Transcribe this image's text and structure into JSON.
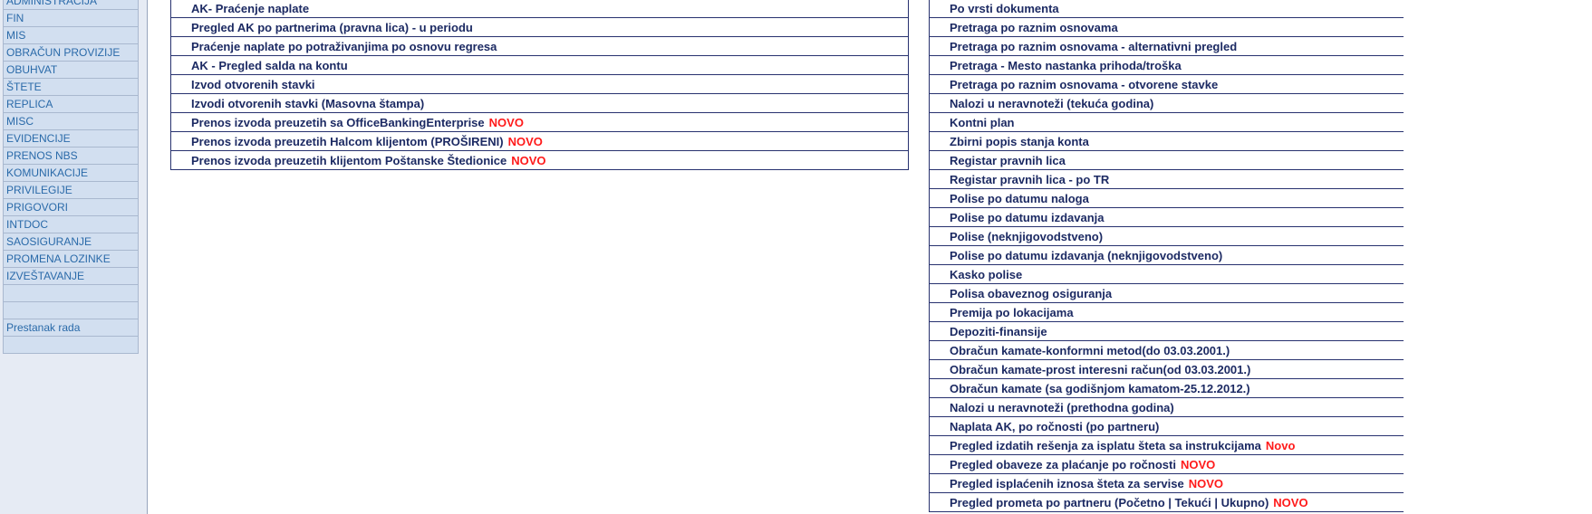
{
  "nav": {
    "items": [
      "ADMINISTRACIJA",
      "FIN",
      "MIS",
      "OBRAČUN PROVIZIJE",
      "OBUHVAT",
      "ŠTETE",
      "REPLICA",
      "MISC",
      "EVIDENCIJE",
      "PRENOS NBS",
      "KOMUNIKACIJE",
      "PRIVILEGIJE",
      "PRIGOVORI",
      "INTDOC",
      "SAOSIGURANJE",
      "PROMENA LOZINKE",
      "IZVEŠTAVANJE",
      "",
      "",
      "Prestanak rada",
      ""
    ]
  },
  "left_reports": [
    {
      "label": "AK- Praćenje naplate",
      "badge": ""
    },
    {
      "label": "Pregled AK po partnerima (pravna lica) - u periodu",
      "badge": ""
    },
    {
      "label": "Praćenje naplate po potraživanjima po osnovu regresa",
      "badge": ""
    },
    {
      "label": "AK - Pregled salda na kontu",
      "badge": ""
    },
    {
      "label": "Izvod otvorenih stavki",
      "badge": ""
    },
    {
      "label": "Izvodi otvorenih stavki (Masovna štampa)",
      "badge": ""
    },
    {
      "label": "Prenos izvoda preuzetih sa OfficeBankingEnterprise",
      "badge": "NOVO"
    },
    {
      "label": "Prenos izvoda preuzetih Halcom klijentom (PROŠIRENI)",
      "badge": "NOVO"
    },
    {
      "label": "Prenos izvoda preuzetih klijentom Poštanske Štedionice",
      "badge": "NOVO"
    }
  ],
  "right_reports": [
    {
      "label": "Po vrsti dokumenta",
      "badge": ""
    },
    {
      "label": "Pretraga po raznim osnovama",
      "badge": ""
    },
    {
      "label": "Pretraga po raznim osnovama - alternativni pregled",
      "badge": ""
    },
    {
      "label": "Pretraga - Mesto nastanka prihoda/troška",
      "badge": ""
    },
    {
      "label": "Pretraga po raznim osnovama - otvorene stavke",
      "badge": ""
    },
    {
      "label": "Nalozi u neravnoteži (tekuća godina)",
      "badge": ""
    },
    {
      "label": "Kontni plan",
      "badge": ""
    },
    {
      "label": "Zbirni popis stanja konta",
      "badge": ""
    },
    {
      "label": "Registar pravnih lica",
      "badge": ""
    },
    {
      "label": "Registar pravnih lica - po TR",
      "badge": ""
    },
    {
      "label": "Polise po datumu naloga",
      "badge": ""
    },
    {
      "label": "Polise po datumu izdavanja",
      "badge": ""
    },
    {
      "label": "Polise (neknjigovodstveno)",
      "badge": ""
    },
    {
      "label": "Polise po datumu izdavanja (neknjigovodstveno)",
      "badge": ""
    },
    {
      "label": "Kasko polise",
      "badge": ""
    },
    {
      "label": "Polisa obaveznog osiguranja",
      "badge": ""
    },
    {
      "label": "Premija po lokacijama",
      "badge": ""
    },
    {
      "label": "Depoziti-finansije",
      "badge": ""
    },
    {
      "label": "Obračun kamate-konformni metod(do 03.03.2001.)",
      "badge": ""
    },
    {
      "label": "Obračun kamate-prost interesni račun(od 03.03.2001.)",
      "badge": ""
    },
    {
      "label": "Obračun kamate (sa godišnjom kamatom-25.12.2012.)",
      "badge": ""
    },
    {
      "label": "Nalozi u neravnoteži (prethodna godina)",
      "badge": ""
    },
    {
      "label": "Naplata AK, po ročnosti (po partneru)",
      "badge": ""
    },
    {
      "label": "Pregled izdatih rešenja za isplatu šteta sa instrukcijama",
      "badge": "Novo"
    },
    {
      "label": "Pregled obaveze za plaćanje po ročnosti",
      "badge": "NOVO"
    },
    {
      "label": "Pregled isplaćenih iznosa šteta za servise",
      "badge": "NOVO"
    },
    {
      "label": "Pregled prometa po partneru (Početno | Tekući | Ukupno)",
      "badge": "NOVO"
    }
  ],
  "colors": {
    "link_text": "#1c2a63",
    "badge": "#ff1a1a",
    "nav_text": "#2a6aa9",
    "nav_bg": "#d2dff0",
    "pane_bg": "#e6ebf4"
  }
}
